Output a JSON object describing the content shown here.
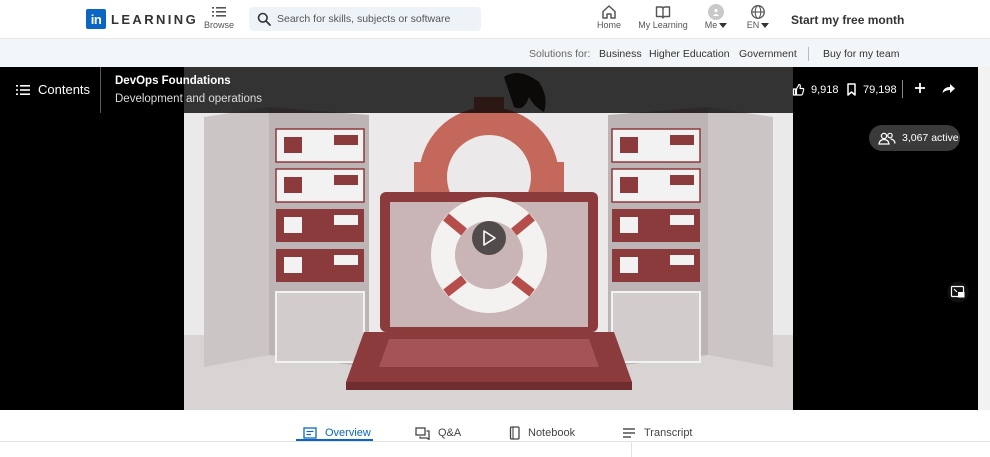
{
  "brand": {
    "logo_mark": "in",
    "logo_text": "LEARNING",
    "brand_color": "#0a66c2"
  },
  "nav": {
    "browse_label": "Browse",
    "search_placeholder": "Search for skills, subjects or software",
    "home_label": "Home",
    "my_learning_label": "My Learning",
    "me_label": "Me",
    "lang_label": "EN",
    "free_month_label": "Start my free month"
  },
  "subbar": {
    "solutions_label": "Solutions for:",
    "links": [
      "Business",
      "Higher Education",
      "Government"
    ],
    "buy_label": "Buy for my team"
  },
  "player": {
    "contents_label": "Contents",
    "course_title": "DevOps Foundations",
    "course_subtitle": "Development and operations",
    "likes": "9,918",
    "saves": "79,198",
    "active_count": "3,067 active",
    "icons": [
      "menu-icon",
      "thumbs-up-icon",
      "bookmark-icon",
      "plus-icon",
      "share-icon",
      "people-icon",
      "play-icon",
      "pip-icon"
    ]
  },
  "tabs": [
    {
      "label": "Overview",
      "active": true
    },
    {
      "label": "Q&A",
      "active": false
    },
    {
      "label": "Notebook",
      "active": false
    },
    {
      "label": "Transcript",
      "active": false
    }
  ]
}
